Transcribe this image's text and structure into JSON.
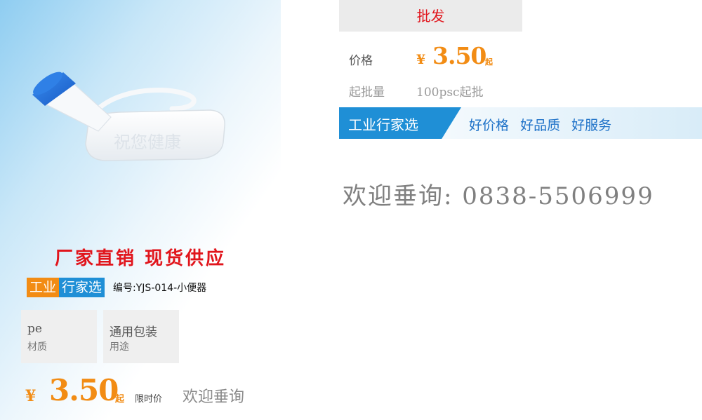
{
  "left": {
    "product_emboss": "祝您健康",
    "headline": "厂家直销  现货供应",
    "brand_part_a": "工业",
    "brand_part_b": "行家选",
    "model_number": "编号:YJS-014-小便器",
    "specs": [
      {
        "value": "pe",
        "label": "材质"
      },
      {
        "value": "通用包装",
        "label": "用途"
      }
    ],
    "price": {
      "currency": "¥",
      "amount": "3.50",
      "unit": "起",
      "limited_label": "限时价",
      "inquiry": "欢迎垂询"
    }
  },
  "right": {
    "tab_label": "批发",
    "price_label": "价格",
    "price_currency": "¥",
    "price_amount": "3.50",
    "price_unit": "起",
    "moq_label": "起批量",
    "moq_value": "100psc起批",
    "banner": {
      "title": "工业行家选",
      "slogans": [
        "好价格",
        "好品质",
        "好服务"
      ]
    },
    "contact": "欢迎垂询: 0838-5506999"
  },
  "colors": {
    "accent_red": "#e1151c",
    "accent_orange": "#f28c14",
    "accent_blue": "#1f8fd6",
    "product_cap": "#1e6fd9",
    "product_body": "#f4f6f8"
  },
  "icons": {
    "product": "urinal-bottle-illustration"
  }
}
